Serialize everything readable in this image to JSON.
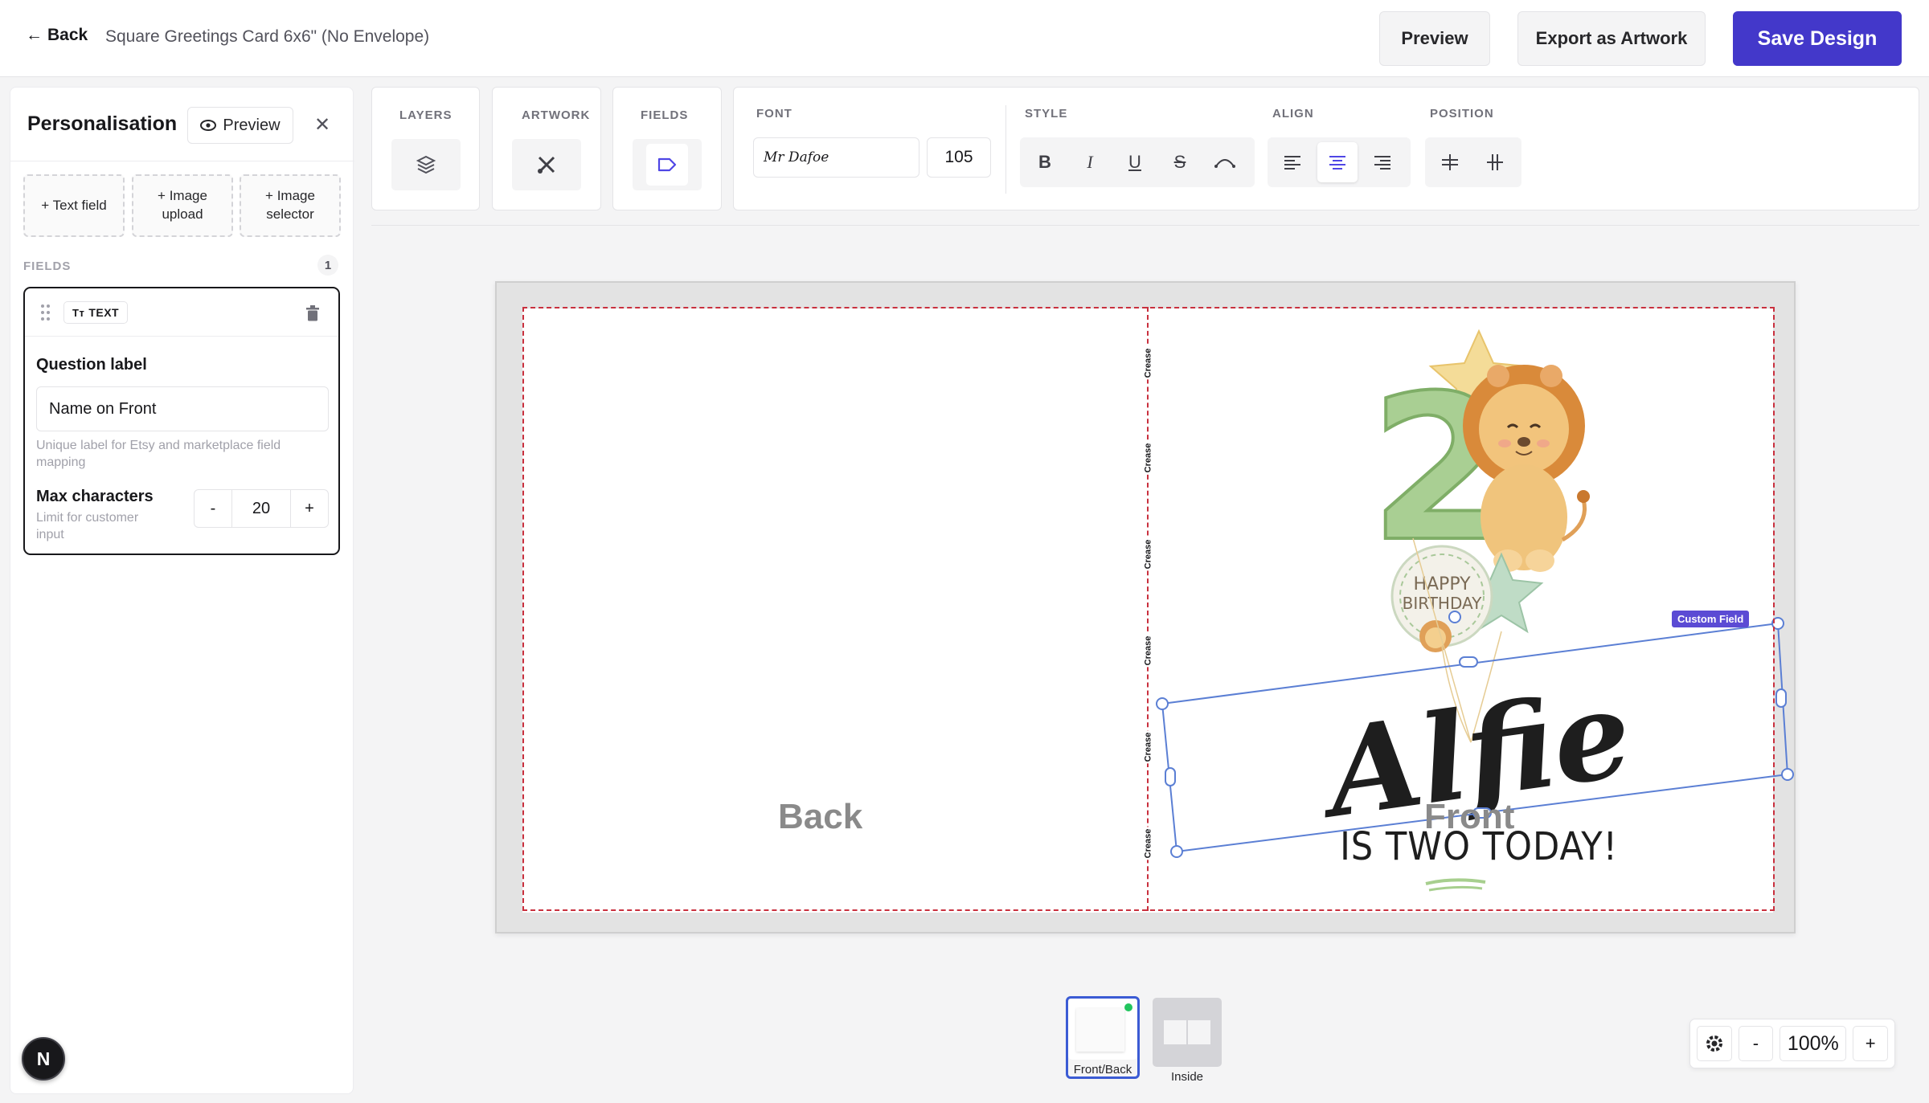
{
  "topbar": {
    "back_label": "Back",
    "doc_title": "Square Greetings Card 6x6\" (No Envelope)",
    "preview_label": "Preview",
    "export_label": "Export as Artwork",
    "save_label": "Save Design"
  },
  "panel": {
    "title": "Personalisation",
    "preview_label": "Preview",
    "add_buttons": [
      "+ Text field",
      "+ Image\nupload",
      "+ Image\nselector"
    ],
    "fields_label": "FIELDS",
    "fields_count": "1",
    "field": {
      "type_tag": "TEXT",
      "question_label": "Question label",
      "question_value": "Name on Front",
      "question_help": "Unique label for Etsy and marketplace field mapping",
      "max_label": "Max characters",
      "max_help": "Limit for customer input",
      "max_value": "20",
      "minus": "-",
      "plus": "+"
    },
    "avatar_letter": "N"
  },
  "toolbar": {
    "layers": "LAYERS",
    "artwork": "ARTWORK",
    "fields": "FIELDS",
    "font": "FONT",
    "font_name": "Mr Dafoe",
    "font_size": "105",
    "style": "STYLE",
    "align": "ALIGN",
    "position": "POSITION",
    "bold": "B",
    "italic": "I",
    "underline": "U",
    "strike": "S"
  },
  "canvas": {
    "crease_text": "Crease",
    "back_label": "Back",
    "front_label": "Front",
    "name_text": "Alfie",
    "subline": "IS TWO TODAY!",
    "balloon_text_1": "HAPPY",
    "balloon_text_2": "BIRTHDAY",
    "big_number": "2",
    "custom_tag": "Custom Field"
  },
  "pages": [
    {
      "label": "Front/Back",
      "active": true
    },
    {
      "label": "Inside",
      "active": false
    }
  ],
  "zoom": {
    "value": "100%",
    "minus": "-",
    "plus": "+"
  },
  "colors": {
    "accent": "#4338ca",
    "bleed": "#c9303e",
    "selection": "#5b7fd4",
    "tag": "#5b4bd4"
  }
}
